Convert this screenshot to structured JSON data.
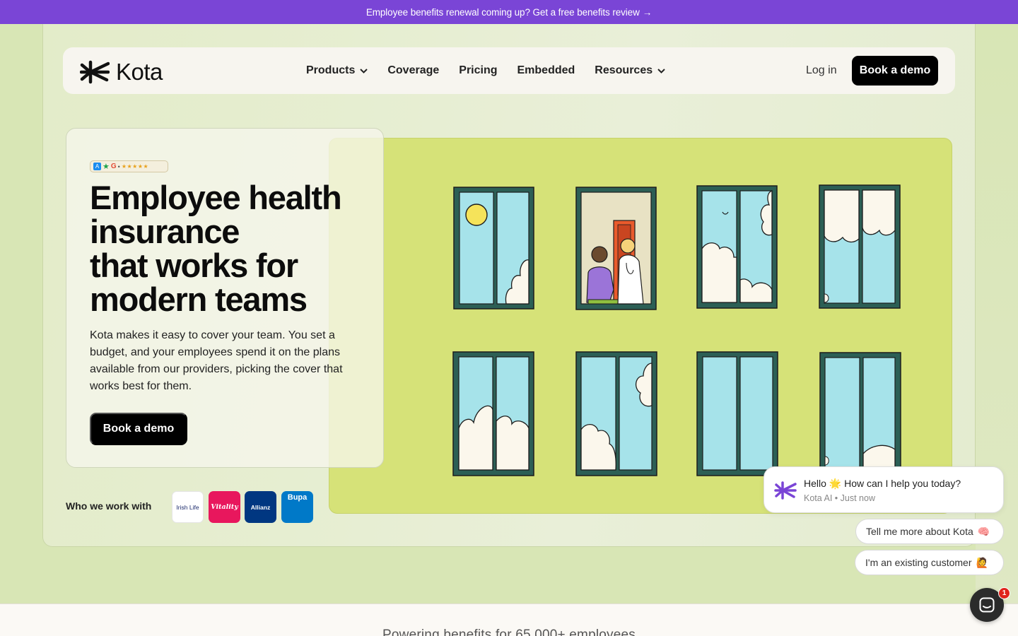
{
  "announcement": {
    "text": "Employee benefits renewal coming up? Get a free benefits review",
    "arrow": "→"
  },
  "nav": {
    "logo_text": "Kota",
    "links": [
      {
        "label": "Products",
        "has_dropdown": true
      },
      {
        "label": "Coverage",
        "has_dropdown": false
      },
      {
        "label": "Pricing",
        "has_dropdown": false
      },
      {
        "label": "Embedded",
        "has_dropdown": false
      },
      {
        "label": "Resources",
        "has_dropdown": true
      }
    ],
    "login_label": "Log in",
    "demo_label": "Book a demo"
  },
  "hero": {
    "rating_badge": {
      "google_letter": "G",
      "stars": "★★★★★"
    },
    "headline_lines": [
      "Employee health",
      "insurance",
      "that works for",
      "modern teams"
    ],
    "subtext": "Kota makes it easy to cover your team. You set a budget, and your employees spend it on the plans available from our providers, picking the cover that works best for them.",
    "cta_label": "Book a demo"
  },
  "partners": {
    "label": "Who we work with",
    "logos": [
      {
        "name": "Irish Life",
        "text": "Irish Life",
        "color": "#ffffff"
      },
      {
        "name": "Vitality",
        "text": "Vitality",
        "color": "#e8175d"
      },
      {
        "name": "Allianz",
        "text": "Allianz",
        "color": "#003781"
      },
      {
        "name": "Bupa",
        "text": "Bupa",
        "color": "#0079c8"
      }
    ]
  },
  "chat": {
    "greeting_prefix": "Hello",
    "greeting_emoji": "🌟",
    "greeting_suffix": "How can I help you today?",
    "sender": "Kota AI",
    "time": "Just now",
    "suggestions": [
      {
        "label": "Tell me more about Kota",
        "emoji": "🧠"
      },
      {
        "label": "I'm an existing customer",
        "emoji": "🙋"
      }
    ],
    "unread_count": "1"
  },
  "footer_teaser": {
    "text": "Powering benefits for 65,000+ employees"
  },
  "colors": {
    "announcement_bg": "#7a45d6",
    "page_bg": "#d8e6b5",
    "illustration_bg": "#d6e278",
    "window_frame": "#2c5f55",
    "sky": "#a6e3ea",
    "button_bg": "#000000"
  }
}
